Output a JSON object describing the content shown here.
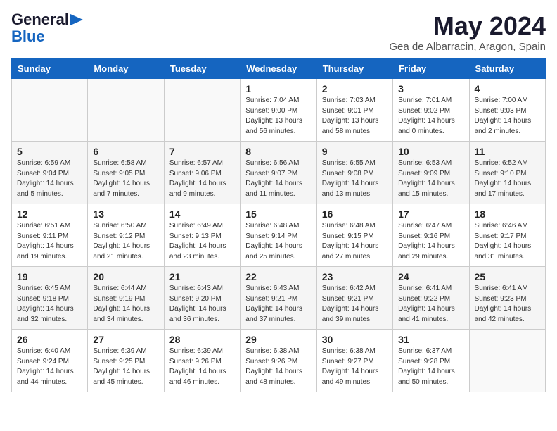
{
  "header": {
    "logo_line1": "General",
    "logo_line2": "Blue",
    "month_title": "May 2024",
    "location": "Gea de Albarracin, Aragon, Spain"
  },
  "weekdays": [
    "Sunday",
    "Monday",
    "Tuesday",
    "Wednesday",
    "Thursday",
    "Friday",
    "Saturday"
  ],
  "weeks": [
    [
      {
        "day": "",
        "info": ""
      },
      {
        "day": "",
        "info": ""
      },
      {
        "day": "",
        "info": ""
      },
      {
        "day": "1",
        "info": "Sunrise: 7:04 AM\nSunset: 9:00 PM\nDaylight: 13 hours\nand 56 minutes."
      },
      {
        "day": "2",
        "info": "Sunrise: 7:03 AM\nSunset: 9:01 PM\nDaylight: 13 hours\nand 58 minutes."
      },
      {
        "day": "3",
        "info": "Sunrise: 7:01 AM\nSunset: 9:02 PM\nDaylight: 14 hours\nand 0 minutes."
      },
      {
        "day": "4",
        "info": "Sunrise: 7:00 AM\nSunset: 9:03 PM\nDaylight: 14 hours\nand 2 minutes."
      }
    ],
    [
      {
        "day": "5",
        "info": "Sunrise: 6:59 AM\nSunset: 9:04 PM\nDaylight: 14 hours\nand 5 minutes."
      },
      {
        "day": "6",
        "info": "Sunrise: 6:58 AM\nSunset: 9:05 PM\nDaylight: 14 hours\nand 7 minutes."
      },
      {
        "day": "7",
        "info": "Sunrise: 6:57 AM\nSunset: 9:06 PM\nDaylight: 14 hours\nand 9 minutes."
      },
      {
        "day": "8",
        "info": "Sunrise: 6:56 AM\nSunset: 9:07 PM\nDaylight: 14 hours\nand 11 minutes."
      },
      {
        "day": "9",
        "info": "Sunrise: 6:55 AM\nSunset: 9:08 PM\nDaylight: 14 hours\nand 13 minutes."
      },
      {
        "day": "10",
        "info": "Sunrise: 6:53 AM\nSunset: 9:09 PM\nDaylight: 14 hours\nand 15 minutes."
      },
      {
        "day": "11",
        "info": "Sunrise: 6:52 AM\nSunset: 9:10 PM\nDaylight: 14 hours\nand 17 minutes."
      }
    ],
    [
      {
        "day": "12",
        "info": "Sunrise: 6:51 AM\nSunset: 9:11 PM\nDaylight: 14 hours\nand 19 minutes."
      },
      {
        "day": "13",
        "info": "Sunrise: 6:50 AM\nSunset: 9:12 PM\nDaylight: 14 hours\nand 21 minutes."
      },
      {
        "day": "14",
        "info": "Sunrise: 6:49 AM\nSunset: 9:13 PM\nDaylight: 14 hours\nand 23 minutes."
      },
      {
        "day": "15",
        "info": "Sunrise: 6:48 AM\nSunset: 9:14 PM\nDaylight: 14 hours\nand 25 minutes."
      },
      {
        "day": "16",
        "info": "Sunrise: 6:48 AM\nSunset: 9:15 PM\nDaylight: 14 hours\nand 27 minutes."
      },
      {
        "day": "17",
        "info": "Sunrise: 6:47 AM\nSunset: 9:16 PM\nDaylight: 14 hours\nand 29 minutes."
      },
      {
        "day": "18",
        "info": "Sunrise: 6:46 AM\nSunset: 9:17 PM\nDaylight: 14 hours\nand 31 minutes."
      }
    ],
    [
      {
        "day": "19",
        "info": "Sunrise: 6:45 AM\nSunset: 9:18 PM\nDaylight: 14 hours\nand 32 minutes."
      },
      {
        "day": "20",
        "info": "Sunrise: 6:44 AM\nSunset: 9:19 PM\nDaylight: 14 hours\nand 34 minutes."
      },
      {
        "day": "21",
        "info": "Sunrise: 6:43 AM\nSunset: 9:20 PM\nDaylight: 14 hours\nand 36 minutes."
      },
      {
        "day": "22",
        "info": "Sunrise: 6:43 AM\nSunset: 9:21 PM\nDaylight: 14 hours\nand 37 minutes."
      },
      {
        "day": "23",
        "info": "Sunrise: 6:42 AM\nSunset: 9:21 PM\nDaylight: 14 hours\nand 39 minutes."
      },
      {
        "day": "24",
        "info": "Sunrise: 6:41 AM\nSunset: 9:22 PM\nDaylight: 14 hours\nand 41 minutes."
      },
      {
        "day": "25",
        "info": "Sunrise: 6:41 AM\nSunset: 9:23 PM\nDaylight: 14 hours\nand 42 minutes."
      }
    ],
    [
      {
        "day": "26",
        "info": "Sunrise: 6:40 AM\nSunset: 9:24 PM\nDaylight: 14 hours\nand 44 minutes."
      },
      {
        "day": "27",
        "info": "Sunrise: 6:39 AM\nSunset: 9:25 PM\nDaylight: 14 hours\nand 45 minutes."
      },
      {
        "day": "28",
        "info": "Sunrise: 6:39 AM\nSunset: 9:26 PM\nDaylight: 14 hours\nand 46 minutes."
      },
      {
        "day": "29",
        "info": "Sunrise: 6:38 AM\nSunset: 9:26 PM\nDaylight: 14 hours\nand 48 minutes."
      },
      {
        "day": "30",
        "info": "Sunrise: 6:38 AM\nSunset: 9:27 PM\nDaylight: 14 hours\nand 49 minutes."
      },
      {
        "day": "31",
        "info": "Sunrise: 6:37 AM\nSunset: 9:28 PM\nDaylight: 14 hours\nand 50 minutes."
      },
      {
        "day": "",
        "info": ""
      }
    ]
  ]
}
